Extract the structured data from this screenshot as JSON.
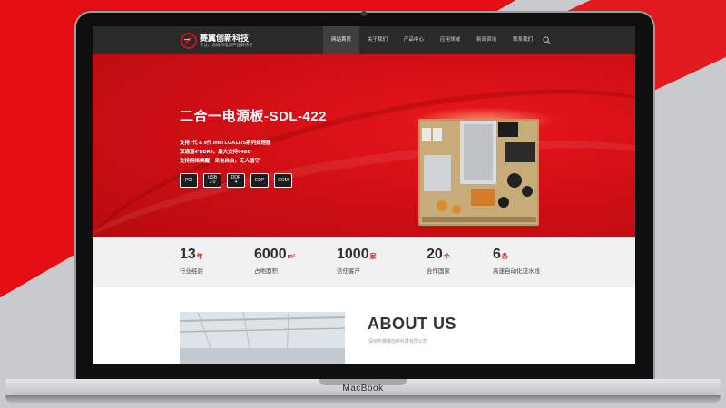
{
  "colors": {
    "accent": "#e30d14",
    "nav_bg": "#2a2a2b"
  },
  "device": {
    "label": "MacBook"
  },
  "site": {
    "brand": "赛翼创新科技",
    "slogan": "专注、高端的电源产品解决者"
  },
  "nav": {
    "items": [
      {
        "label": "网站首页",
        "active": true
      },
      {
        "label": "关于我们"
      },
      {
        "label": "产品中心"
      },
      {
        "label": "应用领域"
      },
      {
        "label": "新闻资讯"
      },
      {
        "label": "联系我们"
      }
    ],
    "search_icon": "search-icon"
  },
  "hero": {
    "title": "二合一电源板-SDL-422",
    "lines": [
      "支持7代 & 8代 Intel LGA1175系列处理器",
      "双通道4*DDR4，最大支持64GB",
      "支持网络唤醒，来电自启，无人值守"
    ],
    "badges": [
      {
        "top": "PCI",
        "bottom": ""
      },
      {
        "top": "USB",
        "bottom": "3.0"
      },
      {
        "top": "DDR",
        "bottom": "4"
      },
      {
        "top": "EDP",
        "bottom": ""
      },
      {
        "top": "COM",
        "bottom": ""
      }
    ]
  },
  "stats": [
    {
      "number": "13",
      "unit": "年",
      "label": "行业经验"
    },
    {
      "number": "6000",
      "unit": "m²",
      "label": "占地面积"
    },
    {
      "number": "1000",
      "unit": "家",
      "label": "信任客户"
    },
    {
      "number": "20",
      "unit": "个",
      "label": "合作国家"
    },
    {
      "number": "6",
      "unit": "条",
      "label": "高速自动化流水线"
    }
  ],
  "about": {
    "title": "ABOUT US",
    "subtitle": "深圳市赛翼创新科技有限公司"
  }
}
